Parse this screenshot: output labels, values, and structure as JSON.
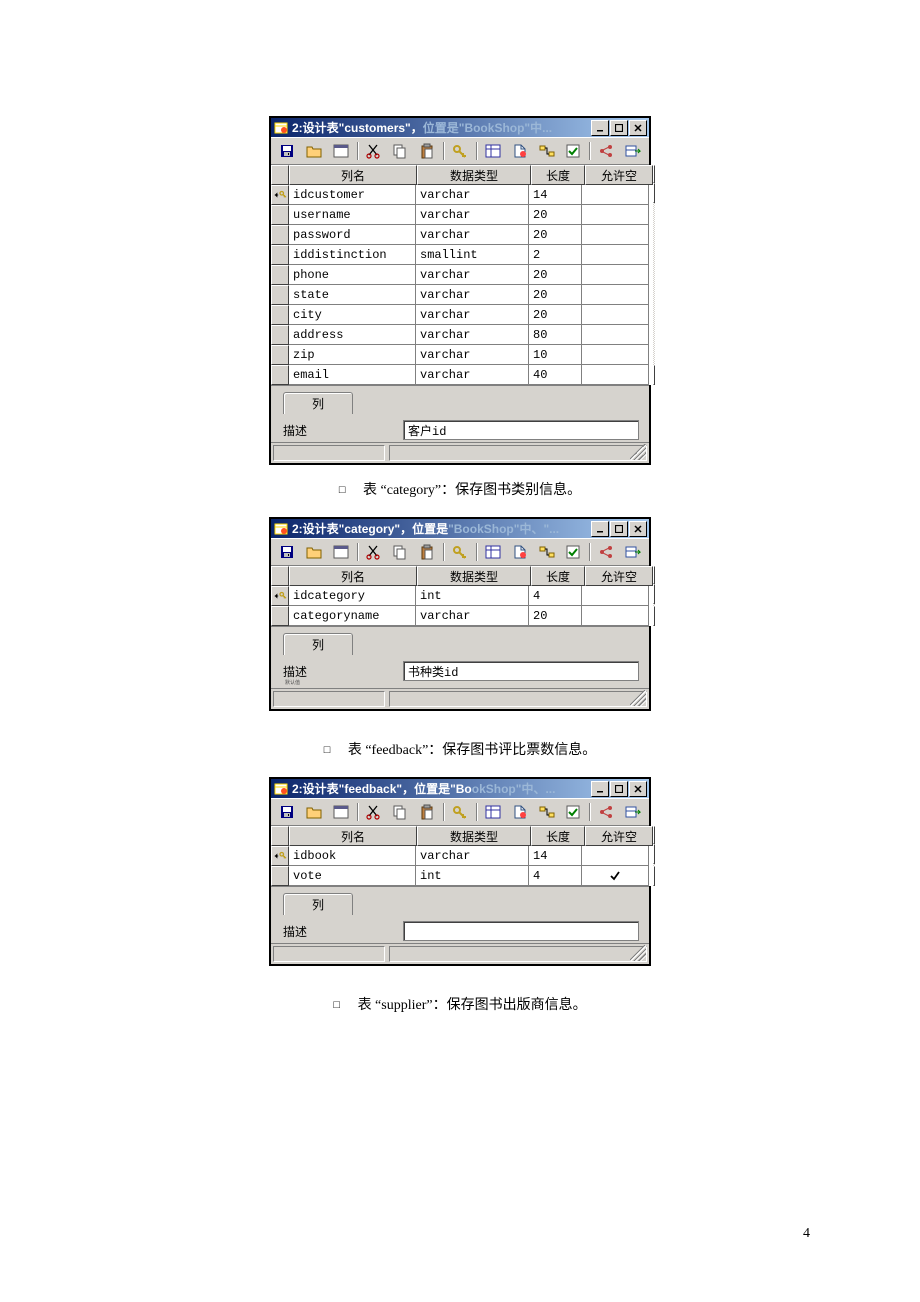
{
  "page_number": "4",
  "captions": {
    "category": "表 “category”：保存图书类别信息。",
    "feedback": "表 “feedback”：保存图书评比票数信息。",
    "supplier": "表 “supplier”：保存图书出版商信息。"
  },
  "bullet": "□",
  "grid_headers": {
    "col_name": "列名",
    "data_type": "数据类型",
    "length": "长度",
    "allow_null": "允许空"
  },
  "tab_label": "列",
  "desc_label": "描述",
  "windows": {
    "customers": {
      "title_bright": "2:设计表\"customers\"，",
      "title_dim": "位置是\"BookShop\"中...",
      "desc_value": "客户id",
      "rows": [
        {
          "name": "idcustomer",
          "type": "varchar",
          "len": "14",
          "null": false,
          "pk": true
        },
        {
          "name": "username",
          "type": "varchar",
          "len": "20",
          "null": false,
          "pk": false
        },
        {
          "name": "password",
          "type": "varchar",
          "len": "20",
          "null": false,
          "pk": false
        },
        {
          "name": "iddistinction",
          "type": "smallint",
          "len": "2",
          "null": false,
          "pk": false
        },
        {
          "name": "phone",
          "type": "varchar",
          "len": "20",
          "null": false,
          "pk": false
        },
        {
          "name": "state",
          "type": "varchar",
          "len": "20",
          "null": false,
          "pk": false
        },
        {
          "name": "city",
          "type": "varchar",
          "len": "20",
          "null": false,
          "pk": false
        },
        {
          "name": "address",
          "type": "varchar",
          "len": "80",
          "null": false,
          "pk": false
        },
        {
          "name": "zip",
          "type": "varchar",
          "len": "10",
          "null": false,
          "pk": false
        },
        {
          "name": "email",
          "type": "varchar",
          "len": "40",
          "null": false,
          "pk": false
        }
      ]
    },
    "category": {
      "title_bright": "2:设计表\"category\"，位置是",
      "title_dim": "\"BookShop\"中、\"...",
      "desc_value": "书种类id",
      "rows": [
        {
          "name": "idcategory",
          "type": "int",
          "len": "4",
          "null": false,
          "pk": true
        },
        {
          "name": "categoryname",
          "type": "varchar",
          "len": "20",
          "null": false,
          "pk": false
        }
      ]
    },
    "feedback": {
      "title_bright": "2:设计表\"feedback\"，位置是\"Bo",
      "title_dim": "okShop\"中、...",
      "desc_value": "",
      "rows": [
        {
          "name": "idbook",
          "type": "varchar",
          "len": "14",
          "null": false,
          "pk": true
        },
        {
          "name": "vote",
          "type": "int",
          "len": "4",
          "null": true,
          "pk": false
        }
      ]
    }
  }
}
